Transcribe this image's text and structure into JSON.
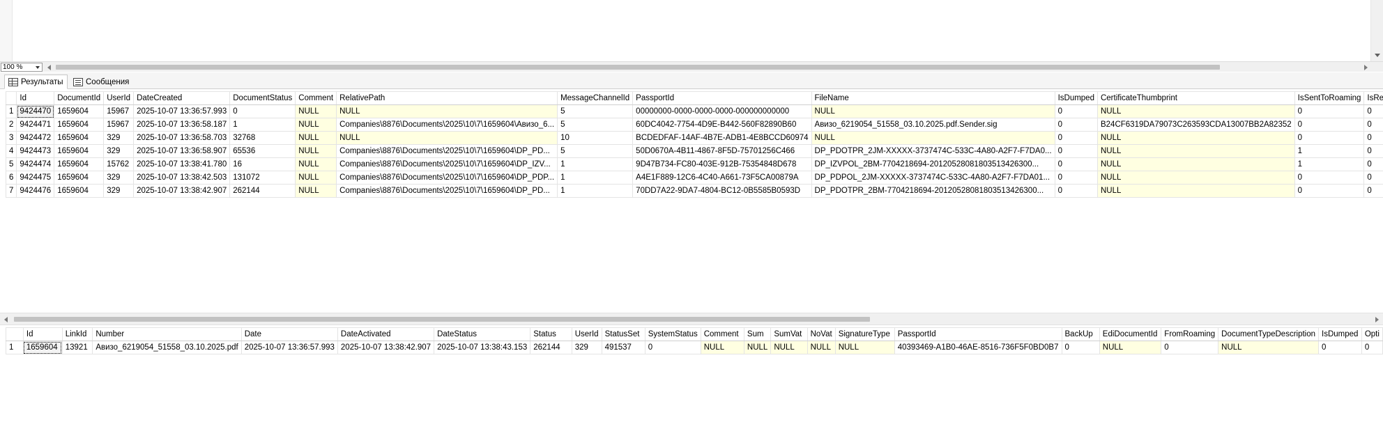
{
  "zoom": {
    "value": "100 %"
  },
  "tabs": [
    {
      "label": "Результаты",
      "icon": "grid-icon"
    },
    {
      "label": "Сообщения",
      "icon": "messages-icon"
    }
  ],
  "grid1": {
    "columns": [
      "",
      "Id",
      "DocumentId",
      "UserId",
      "DateCreated",
      "DocumentStatus",
      "Comment",
      "RelativePath",
      "MessageChannelId",
      "PassportId",
      "FileName",
      "IsDumped",
      "CertificateThumbprint",
      "IsSentToRoaming",
      "IsRece"
    ],
    "rows": [
      [
        "1",
        "9424470",
        "1659604",
        "15967",
        "2025-10-07 13:36:57.993",
        "0",
        "NULL",
        "NULL",
        "5",
        "00000000-0000-0000-0000-000000000000",
        "NULL",
        "0",
        "NULL",
        "0",
        "0"
      ],
      [
        "2",
        "9424471",
        "1659604",
        "15967",
        "2025-10-07 13:36:58.187",
        "1",
        "NULL",
        "Companies\\8876\\Documents\\2025\\10\\7\\1659604\\Авизо_6...",
        "5",
        "60DC4042-7754-4D9E-B442-560F82890B60",
        "Авизо_6219054_51558_03.10.2025.pdf.Sender.sig",
        "0",
        "B24CF6319DA79073C263593CDA13007BB2A82352",
        "0",
        "0"
      ],
      [
        "3",
        "9424472",
        "1659604",
        "329",
        "2025-10-07 13:36:58.703",
        "32768",
        "NULL",
        "NULL",
        "10",
        "BCDEDFAF-14AF-4B7E-ADB1-4E8BCCD60974",
        "NULL",
        "0",
        "NULL",
        "0",
        "0"
      ],
      [
        "4",
        "9424473",
        "1659604",
        "329",
        "2025-10-07 13:36:58.907",
        "65536",
        "NULL",
        "Companies\\8876\\Documents\\2025\\10\\7\\1659604\\DP_PD...",
        "5",
        "50D0670A-4B11-4867-8F5D-75701256C466",
        "DP_PDOTPR_2JM-XXXXX-3737474C-533C-4A80-A2F7-F7DA0...",
        "0",
        "NULL",
        "1",
        "0"
      ],
      [
        "5",
        "9424474",
        "1659604",
        "15762",
        "2025-10-07 13:38:41.780",
        "16",
        "NULL",
        "Companies\\8876\\Documents\\2025\\10\\7\\1659604\\DP_IZV...",
        "1",
        "9D47B734-FC80-403E-912B-75354848D678",
        "DP_IZVPOL_2BM-7704218694-20120528081803513426300...",
        "0",
        "NULL",
        "1",
        "0"
      ],
      [
        "6",
        "9424475",
        "1659604",
        "329",
        "2025-10-07 13:38:42.503",
        "131072",
        "NULL",
        "Companies\\8876\\Documents\\2025\\10\\7\\1659604\\DP_PDP...",
        "1",
        "A4E1F889-12C6-4C40-A661-73F5CA00879A",
        "DP_PDPOL_2JM-XXXXX-3737474C-533C-4A80-A2F7-F7DA01...",
        "0",
        "NULL",
        "0",
        "0"
      ],
      [
        "7",
        "9424476",
        "1659604",
        "329",
        "2025-10-07 13:38:42.907",
        "262144",
        "NULL",
        "Companies\\8876\\Documents\\2025\\10\\7\\1659604\\DP_PD...",
        "1",
        "70DD7A22-9DA7-4804-BC12-0B5585B0593D",
        "DP_PDOTPR_2BM-7704218694-20120528081803513426300...",
        "0",
        "NULL",
        "0",
        "0"
      ]
    ]
  },
  "grid2": {
    "columns": [
      "",
      "Id",
      "LinkId",
      "Number",
      "Date",
      "DateActivated",
      "DateStatus",
      "Status",
      "UserId",
      "StatusSet",
      "SystemStatus",
      "Comment",
      "Sum",
      "SumVat",
      "NoVat",
      "SignatureType",
      "PassportId",
      "BackUp",
      "EdiDocumentId",
      "FromRoaming",
      "DocumentTypeDescription",
      "IsDumped",
      "Opti"
    ],
    "rows": [
      [
        "1",
        "1659604",
        "13921",
        "Авизо_6219054_51558_03.10.2025.pdf",
        "2025-10-07 13:36:57.993",
        "2025-10-07 13:38:42.907",
        "2025-10-07 13:38:43.153",
        "262144",
        "329",
        "491537",
        "0",
        "NULL",
        "NULL",
        "NULL",
        "NULL",
        "NULL",
        "40393469-A1B0-46AE-8516-736F5F0BD0B7",
        "0",
        "NULL",
        "0",
        "NULL",
        "0",
        "0"
      ]
    ]
  }
}
